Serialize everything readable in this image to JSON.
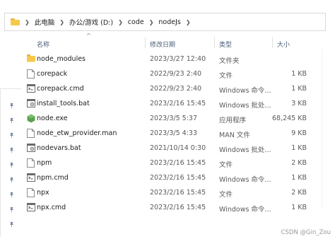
{
  "breadcrumb": [
    "此电脑",
    "办公/游戏 (D:)",
    "code",
    "nodeJs"
  ],
  "columns": {
    "name": "名称",
    "date": "修改日期",
    "type": "类型",
    "size": "大小"
  },
  "files": [
    {
      "name": "node_modules",
      "date": "2023/3/27 12:40",
      "type": "文件夹",
      "size": "",
      "icon": "folder-icon"
    },
    {
      "name": "corepack",
      "date": "2022/9/23 2:40",
      "type": "文件",
      "size": "1 KB",
      "icon": "file-icon"
    },
    {
      "name": "corepack.cmd",
      "date": "2022/9/23 2:40",
      "type": "Windows 命令...",
      "size": "1 KB",
      "icon": "cmd-icon"
    },
    {
      "name": "install_tools.bat",
      "date": "2023/2/16 15:45",
      "type": "Windows 批处...",
      "size": "3 KB",
      "icon": "bat-icon"
    },
    {
      "name": "node.exe",
      "date": "2023/3/5 5:37",
      "type": "应用程序",
      "size": "68,245 KB",
      "icon": "node-exe-icon"
    },
    {
      "name": "node_etw_provider.man",
      "date": "2023/3/5 4:33",
      "type": "MAN 文件",
      "size": "9 KB",
      "icon": "file-icon"
    },
    {
      "name": "nodevars.bat",
      "date": "2021/10/14 0:30",
      "type": "Windows 批处...",
      "size": "1 KB",
      "icon": "bat-icon"
    },
    {
      "name": "npm",
      "date": "2023/2/16 15:45",
      "type": "文件",
      "size": "2 KB",
      "icon": "file-icon"
    },
    {
      "name": "npm.cmd",
      "date": "2023/2/16 15:45",
      "type": "Windows 命令...",
      "size": "1 KB",
      "icon": "cmd-icon"
    },
    {
      "name": "npx",
      "date": "2023/2/16 15:45",
      "type": "文件",
      "size": "2 KB",
      "icon": "file-icon"
    },
    {
      "name": "npx.cmd",
      "date": "2023/2/16 15:45",
      "type": "Windows 命令...",
      "size": "1 KB",
      "icon": "cmd-icon"
    }
  ],
  "watermark": "CSDN @Gin_Zou",
  "colors": {
    "folder": "#f7c94b",
    "node_green": "#5fa04e",
    "header_text": "#4c607a"
  }
}
